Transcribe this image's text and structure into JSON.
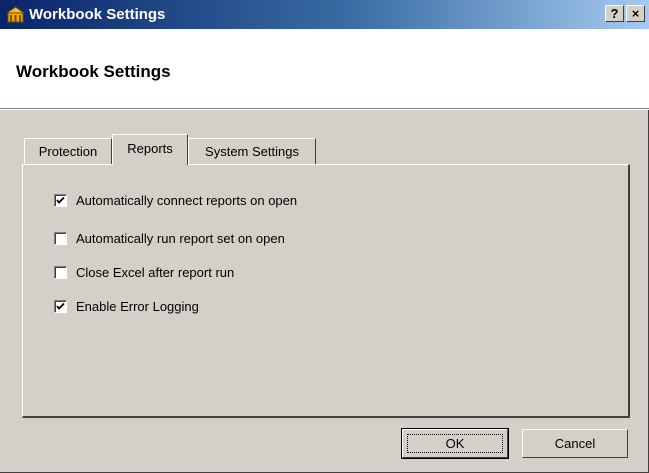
{
  "window": {
    "title": "Workbook Settings",
    "help_button": "?",
    "close_button": "×"
  },
  "header": {
    "title": "Workbook Settings"
  },
  "tabs": [
    {
      "label": "Protection",
      "active": false
    },
    {
      "label": "Reports",
      "active": true
    },
    {
      "label": "System Settings",
      "active": false
    }
  ],
  "options": [
    {
      "label": "Automatically connect reports on open",
      "mnemonic": "A",
      "checked": true
    },
    {
      "label": "Automatically run report set on open",
      "mnemonic": "r",
      "checked": false
    },
    {
      "label": "Close Excel after report run",
      "mnemonic": "l",
      "checked": false
    },
    {
      "label": "Enable Error Logging",
      "mnemonic": "",
      "checked": true
    }
  ],
  "buttons": {
    "ok": "OK",
    "cancel": "Cancel"
  },
  "colors": {
    "titlebar_start": "#0a246a",
    "titlebar_end": "#a6caf0",
    "dialog_bg": "#d4d0c8"
  }
}
